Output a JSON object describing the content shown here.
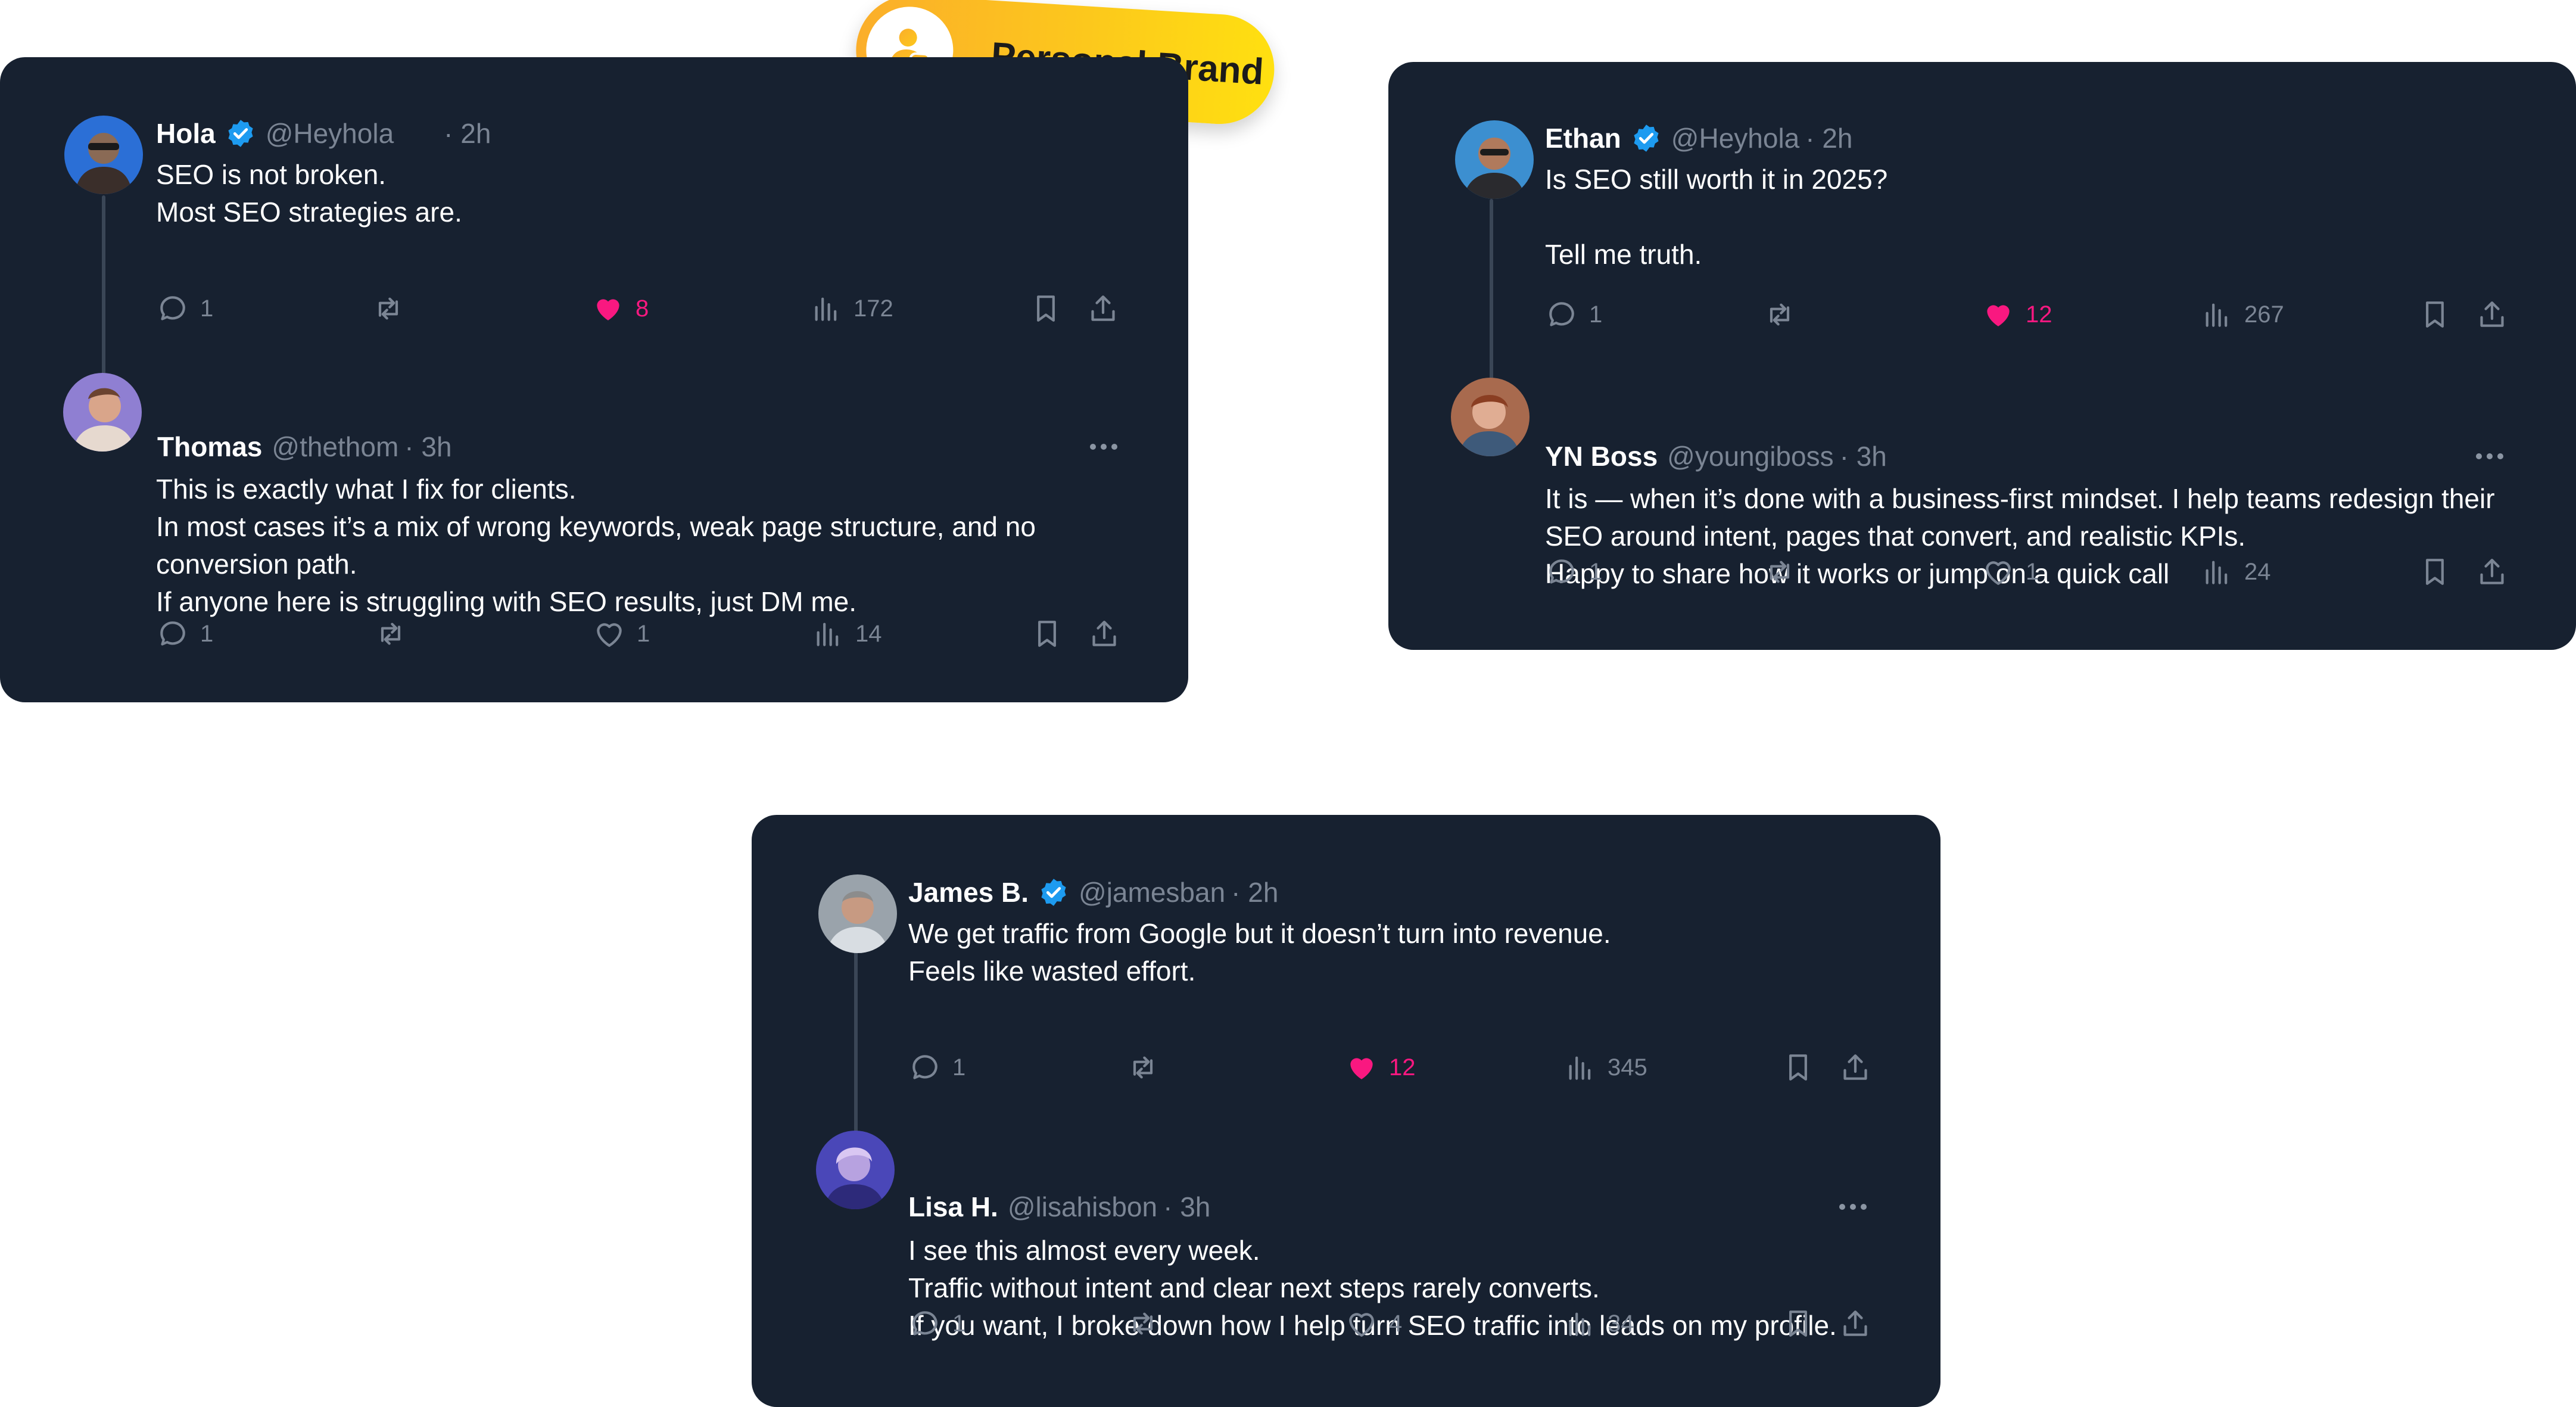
{
  "badge": {
    "label": "Personal Brand",
    "icon": "user-check-icon"
  },
  "colors": {
    "card_bg": "#172130",
    "muted": "#7b8594",
    "like": "#f91880",
    "verified": "#1d9bf0",
    "badge_start": "#fbae2a",
    "badge_end": "#ffe010"
  },
  "cards": [
    {
      "post": {
        "name": "Hola",
        "verified": true,
        "handle": "@Heyhola",
        "time": "· 2h",
        "lines": [
          "SEO is not broken.",
          "Most SEO strategies are."
        ],
        "stats": {
          "replies": "1",
          "likes": "8",
          "views": "172"
        },
        "liked": true
      },
      "reply": {
        "name": "Thomas",
        "verified": false,
        "handle": "@thethom",
        "time": "· 3h",
        "lines": [
          "This is exactly what I fix for clients.",
          "In most cases it’s a mix of wrong keywords, weak page structure, and no",
          "conversion path.",
          "If anyone here is struggling with SEO results, just DM me."
        ],
        "stats": {
          "replies": "1",
          "likes": "1",
          "views": "14"
        },
        "liked": false
      }
    },
    {
      "post": {
        "name": "Ethan",
        "verified": true,
        "handle": "@Heyhola",
        "time": "· 2h",
        "lines": [
          "Is SEO still worth it in 2025?",
          "",
          "Tell me truth."
        ],
        "stats": {
          "replies": "1",
          "likes": "12",
          "views": "267"
        },
        "liked": true
      },
      "reply": {
        "name": "YN Boss",
        "verified": false,
        "handle": "@youngiboss",
        "time": "· 3h",
        "lines": [
          "It is — when it’s done with a business-first mindset. I help teams redesign their",
          "SEO around intent, pages that convert, and realistic KPIs.",
          "Happy to share how it works or jump on a quick call"
        ],
        "stats": {
          "replies": "1",
          "likes": "1",
          "views": "24"
        },
        "liked": false
      }
    },
    {
      "post": {
        "name": "James B.",
        "verified": true,
        "handle": "@jamesban",
        "time": "· 2h",
        "lines": [
          "We get traffic from Google but it doesn’t turn into revenue.",
          "Feels like wasted effort."
        ],
        "stats": {
          "replies": "1",
          "likes": "12",
          "views": "345"
        },
        "liked": true
      },
      "reply": {
        "name": "Lisa H.",
        "verified": false,
        "handle": "@lisahisbon",
        "time": "· 3h",
        "lines": [
          "I see this almost every week.",
          "Traffic without intent and clear next steps rarely converts.",
          "If you want, I broke down how I help turn SEO traffic into leads on my profile."
        ],
        "stats": {
          "replies": "1",
          "likes": "4",
          "views": "34"
        },
        "liked": false
      }
    }
  ]
}
